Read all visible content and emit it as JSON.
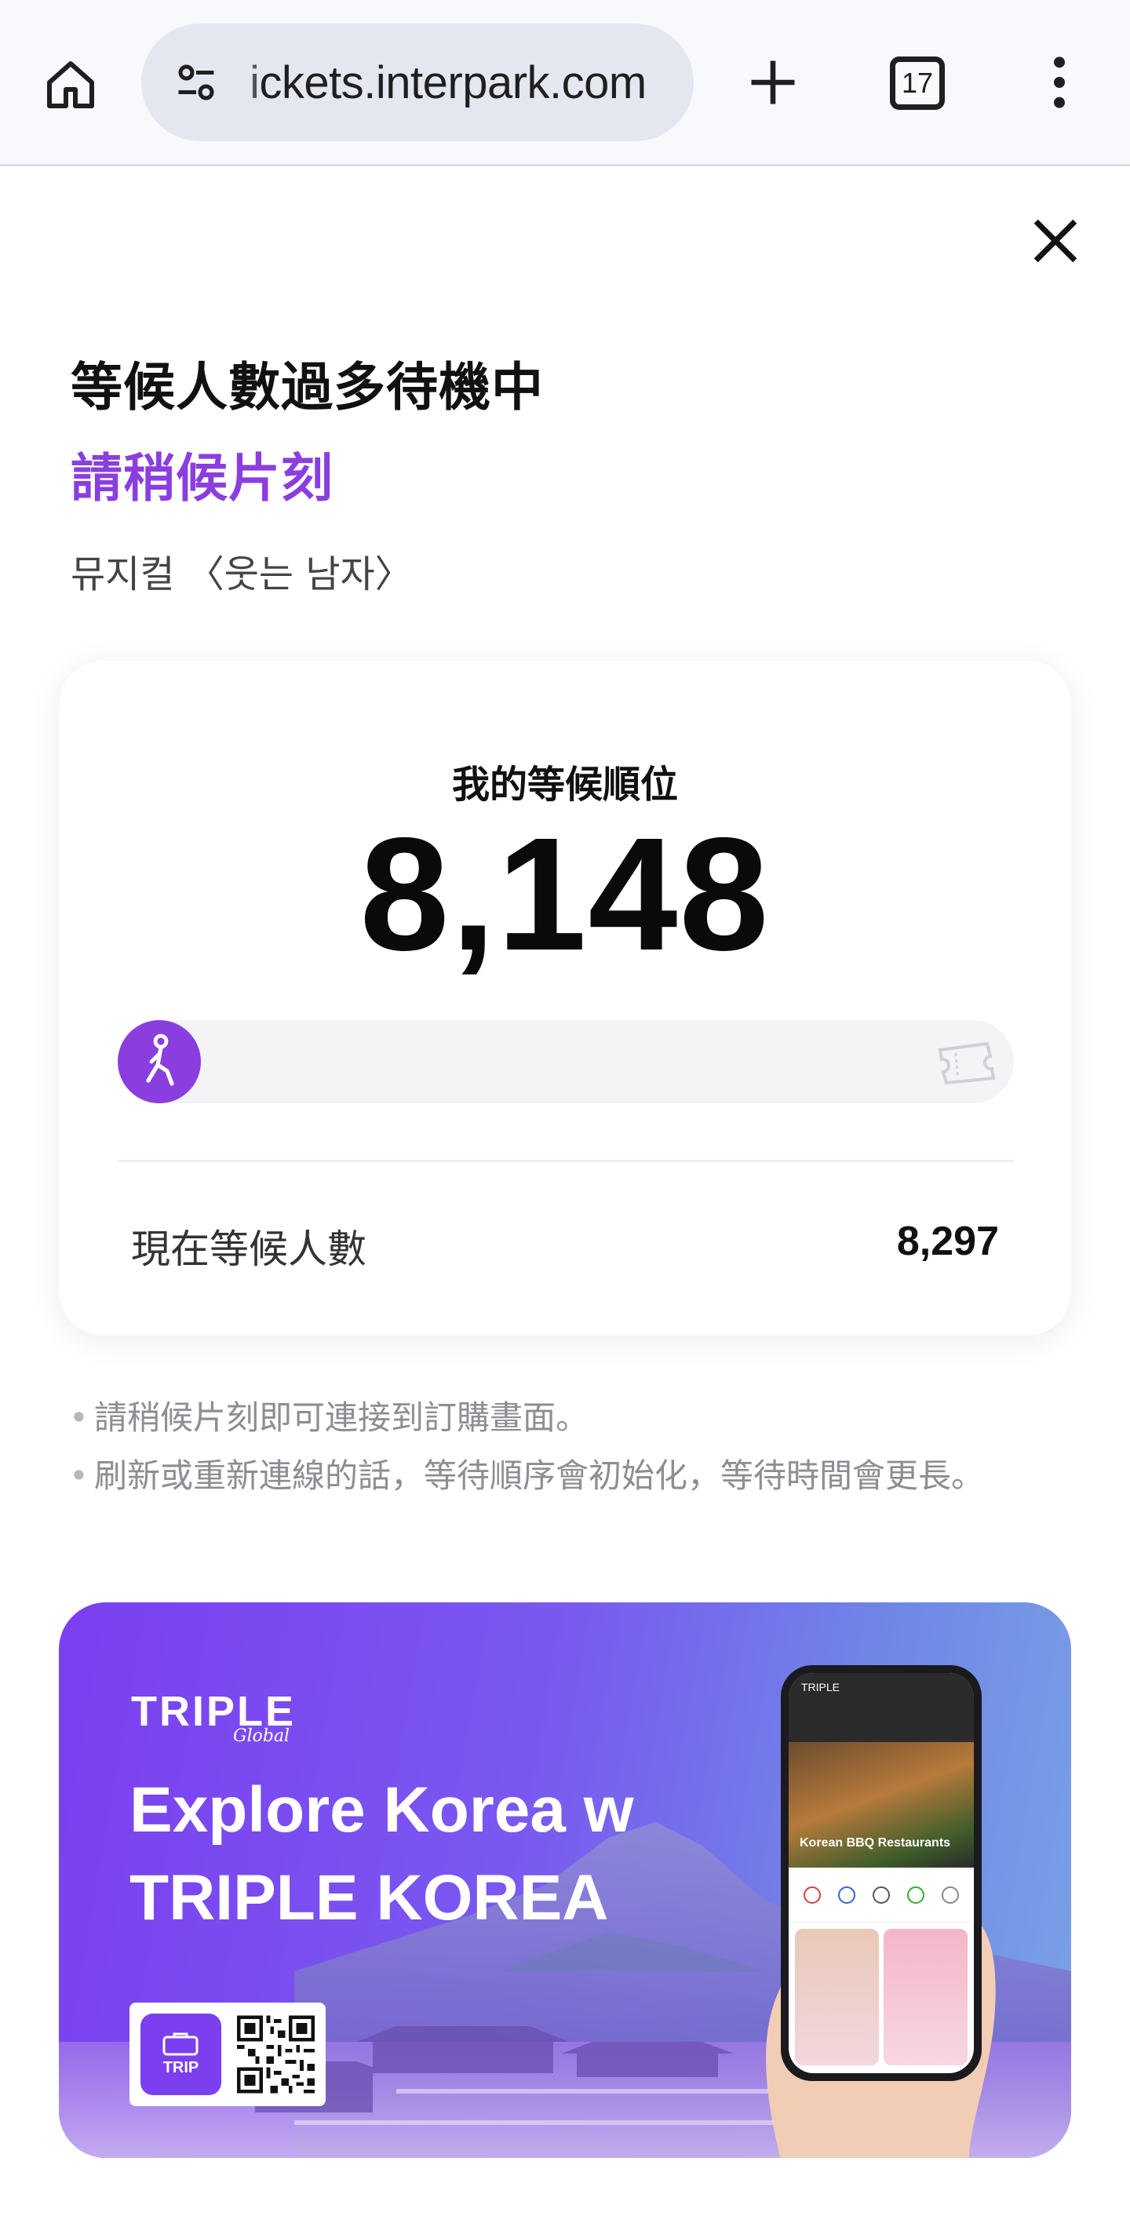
{
  "browser": {
    "url": "ickets.interpark.com",
    "tab_count": "17"
  },
  "queue": {
    "headline": "等候人數過多待機中",
    "subheadline": "請稍候片刻",
    "event_title": "뮤지컬 〈웃는 남자〉",
    "rank_label": "我的等候順位",
    "rank_value": "8,148",
    "progress_fraction": 0.0,
    "waiting_label": "現在等候人數",
    "waiting_value": "8,297"
  },
  "notes": [
    "請稍候片刻即可連接到訂購畫面。",
    "刷新或重新連線的話，等待順序會初始化，等待時間會更長。"
  ],
  "banner": {
    "brand": "TRIPLE",
    "brand_sub": "Global",
    "line1": "Explore Korea w",
    "line2": "TRIPLE KOREA",
    "app_tile_label": "TRIP",
    "phone_card_title": "Korean BBQ Restaurants"
  },
  "colors": {
    "accent": "#8a3ee0",
    "banner_start": "#7b3ff0",
    "banner_end": "#7aa2e6"
  }
}
